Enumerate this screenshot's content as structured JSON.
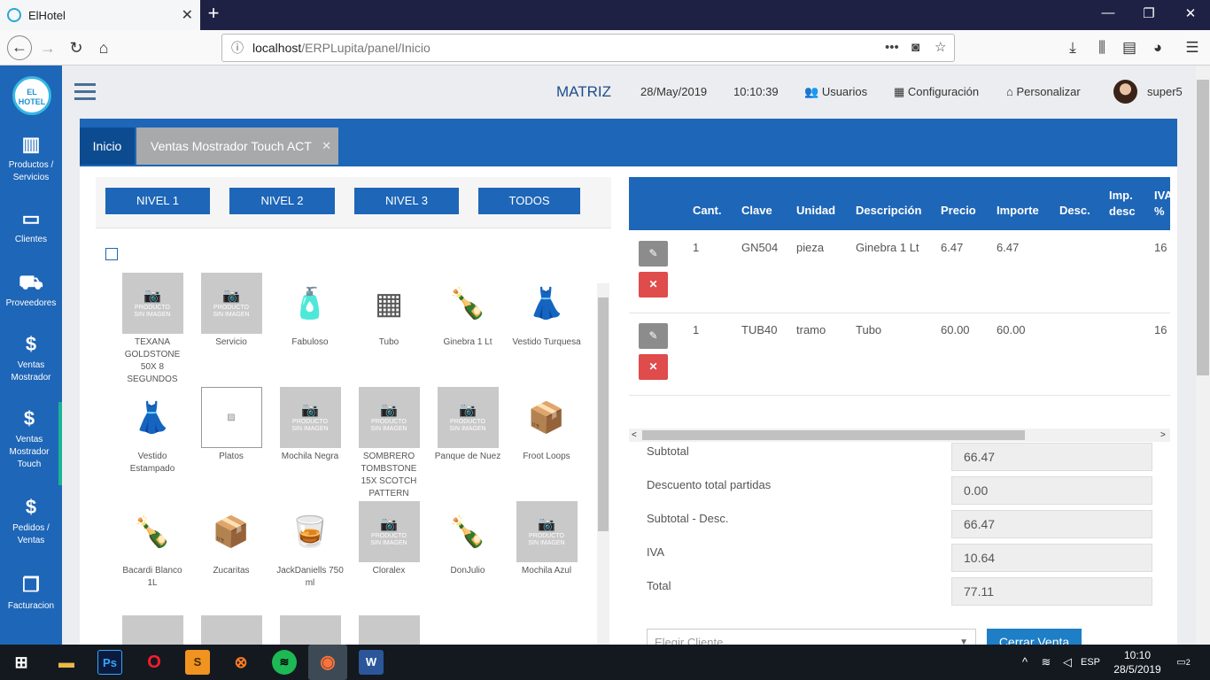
{
  "browser": {
    "tab_title": "ElHotel",
    "url_host": "localhost",
    "url_path": "/ERPLupita/panel/Inicio"
  },
  "sidebar": {
    "logo": "EL HOTEL",
    "items": [
      {
        "label": "Productos / Servicios",
        "icon": "barcode-icon"
      },
      {
        "label": "Clientes",
        "icon": "credit-card-icon"
      },
      {
        "label": "Proveedores",
        "icon": "truck-icon"
      },
      {
        "label": "Ventas Mostrador",
        "icon": "dollar-icon"
      },
      {
        "label": "Ventas Mostrador Touch",
        "icon": "dollar-icon"
      },
      {
        "label": "Pedidos / Ventas",
        "icon": "dollar-icon"
      },
      {
        "label": "Facturacion",
        "icon": "copy-icon"
      }
    ]
  },
  "header": {
    "branch": "MATRIZ",
    "date": "28/May/2019",
    "time": "10:10:39",
    "usuarios": "Usuarios",
    "configuracion": "Configuración",
    "personalizar": "Personalizar",
    "user": "super5"
  },
  "tabs": {
    "inicio": "Inicio",
    "ventas": "Ventas Mostrador Touch ACT"
  },
  "levels": [
    "NIVEL 1",
    "NIVEL 2",
    "NIVEL 3",
    "TODOS"
  ],
  "placeholder_img": {
    "line1": "PRODUCTO",
    "line2": "SIN IMAGEN"
  },
  "products": [
    "TEXANA GOLDSTONE 50X 8 SEGUNDOS",
    "Servicio",
    "Fabuloso",
    "Tubo",
    "Ginebra 1 Lt",
    "Vestido Turquesa",
    "Vestido Estampado",
    "Platos",
    "Mochila Negra",
    "SOMBRERO TOMBSTONE 15X SCOTCH PATTERN",
    "Panque de Nuez",
    "Froot Loops",
    "Bacardi Blanco 1L",
    "Zucaritas",
    "JackDaniells 750 ml",
    "Cloralex",
    "DonJulio",
    "Mochila Azul"
  ],
  "order": {
    "headers": [
      "Cant.",
      "Clave",
      "Unidad",
      "Descripción",
      "Precio",
      "Importe",
      "Desc.",
      "Imp. desc",
      "IVA %"
    ],
    "rows": [
      {
        "cant": "1",
        "clave": "GN504",
        "unidad": "pieza",
        "descripcion": "Ginebra 1 Lt",
        "precio": "6.47",
        "importe": "6.47",
        "iva": "16"
      },
      {
        "cant": "1",
        "clave": "TUB40",
        "unidad": "tramo",
        "descripcion": "Tubo",
        "precio": "60.00",
        "importe": "60.00",
        "iva": "16"
      }
    ]
  },
  "totals": {
    "subtotal_label": "Subtotal",
    "subtotal": "66.47",
    "desc_label": "Descuento total partidas",
    "desc": "0.00",
    "subdesc_label": "Subtotal - Desc.",
    "subdesc": "66.47",
    "iva_label": "IVA",
    "iva": "10.64",
    "total_label": "Total",
    "total": "77.11"
  },
  "client_select": "Elegir Cliente",
  "close_sale": "Cerrar Venta",
  "taskbar": {
    "lang": "ESP",
    "time": "10:10",
    "date": "28/5/2019",
    "notifications": "2"
  }
}
